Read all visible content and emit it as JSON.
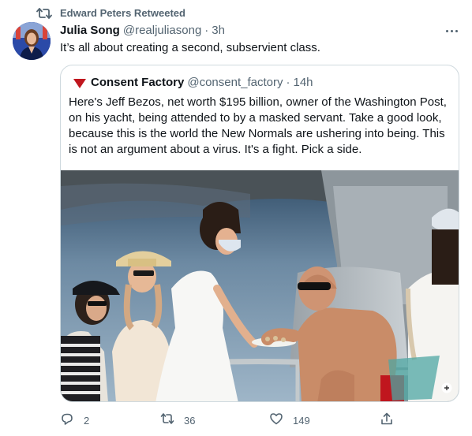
{
  "retweet_banner": {
    "text": "Edward Peters Retweeted",
    "icon": "retweet-icon"
  },
  "tweet": {
    "author_name": "Julia Song",
    "author_handle": "@realjuliasong",
    "separator": "·",
    "time": "3h",
    "text": "It’s all about creating a second, subservient class.",
    "more_icon": "more-horizontal-icon"
  },
  "quote": {
    "author_name": "Consent Factory",
    "author_handle": "@consent_factory",
    "separator": "·",
    "time": "14h",
    "text": "Here's Jeff Bezos, net worth $195 billion, owner of the Washington Post, on his yacht, being attended to by a masked servant. Take a good look, because this is the world the New Normals are ushering into being. This is not an argument about a virus. It's a fight. Pick a side.",
    "avatar_icon": "red-triangle-logo",
    "media_alt": "photo on a yacht deck"
  },
  "actions": {
    "reply_count": "2",
    "retweet_count": "36",
    "like_count": "149"
  },
  "colors": {
    "text": "#0f1419",
    "secondary": "#536471",
    "border": "#cfd9de",
    "brand_red": "#c0161e"
  }
}
